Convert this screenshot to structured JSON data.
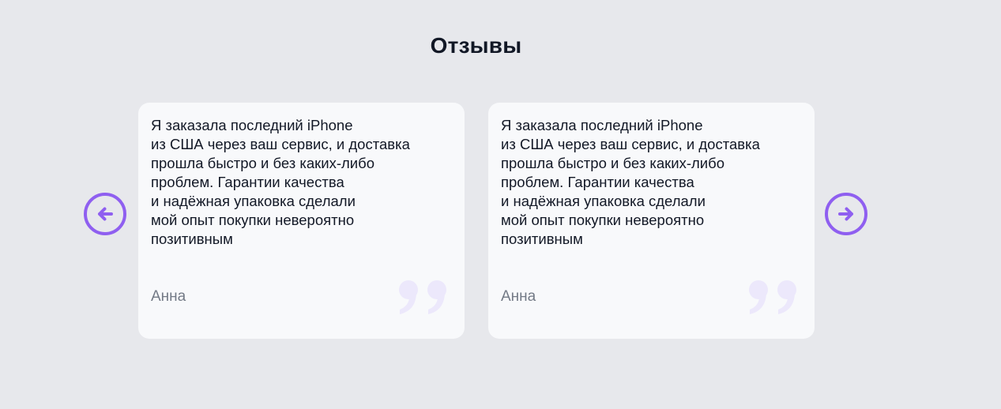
{
  "section": {
    "title": "Отзывы"
  },
  "carousel": {
    "prev_icon": "arrow-left-circle-icon",
    "next_icon": "arrow-right-circle-icon",
    "accent_color": "#8f5ff0"
  },
  "reviews": [
    {
      "text": "Я заказала последний iPhone\nиз США через ваш сервис, и доставка\nпрошла быстро и без каких-либо\nпроблем. Гарантии качества\nи надёжная упаковка сделали\nмой опыт покупки невероятно\nпозитивным",
      "author": "Анна",
      "icon": "quote-icon"
    },
    {
      "text": "Я заказала последний iPhone\nиз США через ваш сервис, и доставка\nпрошла быстро и без каких-либо\nпроблем. Гарантии качества\nи надёжная упаковка сделали\nмой опыт покупки невероятно\nпозитивным",
      "author": "Анна",
      "icon": "quote-icon"
    }
  ]
}
